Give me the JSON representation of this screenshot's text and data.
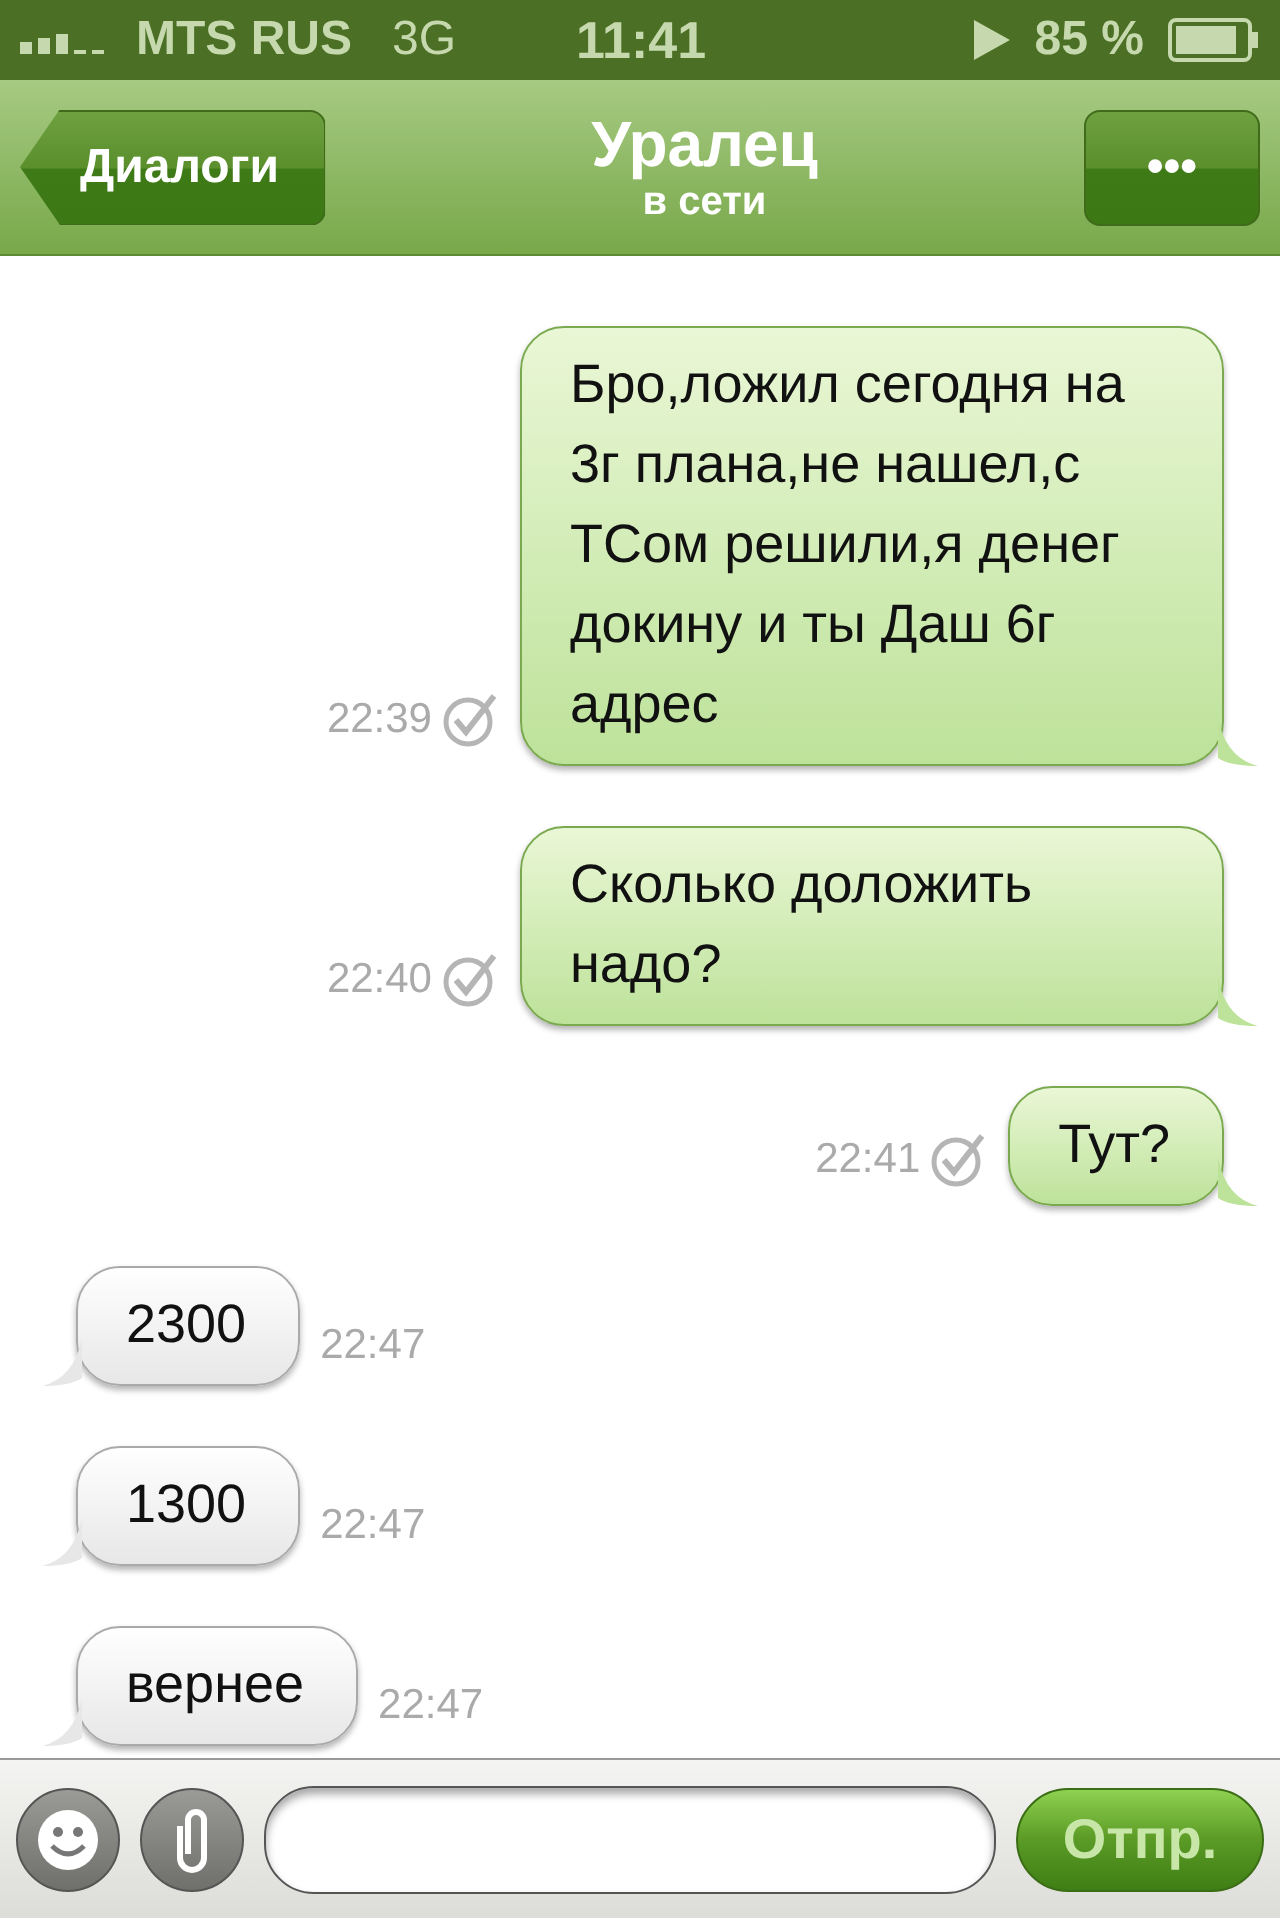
{
  "status_bar": {
    "carrier": "MTS RUS",
    "network": "3G",
    "time": "11:41",
    "battery": "85 %"
  },
  "nav": {
    "back": "Диалоги",
    "title": "Уралец",
    "subtitle": "в сети",
    "menu": "•••"
  },
  "messages": [
    {
      "kind": "outgoing",
      "text": "Бро,ложил сегодня на 3г плана,не нашел,с ТСом решили,я денег докину и ты Даш 6г адрес",
      "time": "22:39"
    },
    {
      "kind": "outgoing",
      "text": "Сколько доложить надо?",
      "time": "22:40"
    },
    {
      "kind": "outgoing",
      "text": "Тут?",
      "time": "22:41"
    },
    {
      "kind": "incoming",
      "text": "2300",
      "time": "22:47"
    },
    {
      "kind": "incoming",
      "text": "1300",
      "time": "22:47"
    },
    {
      "kind": "incoming",
      "text": "вернее",
      "time": "22:47"
    }
  ],
  "composer": {
    "send": "Отпр."
  }
}
